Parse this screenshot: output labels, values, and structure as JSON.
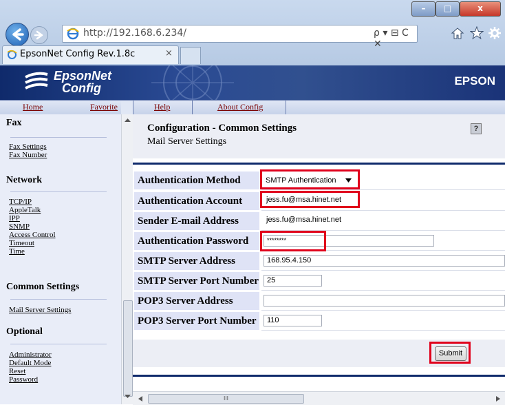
{
  "browser": {
    "url": "http://192.168.6.234/",
    "tab_title": "EpsonNet Config Rev.1.8c",
    "tab_close": "×",
    "search_glyph": "ρ ▾ ⊟ C ✕",
    "minimize": "–",
    "maximize": "□",
    "close": "x"
  },
  "header": {
    "logo_line1": "EpsonNet",
    "logo_line2": "Config",
    "brand": "EPSON"
  },
  "nav": {
    "home": "Home",
    "favorite": "Favorite",
    "help": "Help",
    "about": "About Config"
  },
  "sidebar": {
    "fax": {
      "title": "Fax",
      "links": [
        "Fax Settings",
        "Fax Number"
      ]
    },
    "network": {
      "title": "Network",
      "links": [
        "TCP/IP",
        "AppleTalk",
        "IPP",
        "SNMP",
        "Access Control",
        "Timeout",
        "Time"
      ]
    },
    "common": {
      "title": "Common Settings",
      "links": [
        "Mail Server Settings"
      ]
    },
    "optional": {
      "title": "Optional",
      "links": [
        "Administrator",
        "Default Mode",
        "Reset",
        "Password"
      ]
    }
  },
  "page": {
    "title": "Configuration - Common Settings",
    "subtitle": "Mail Server Settings",
    "help_icon": "?"
  },
  "form": {
    "auth_method": {
      "label": "Authentication Method",
      "value": "SMTP Authentication"
    },
    "auth_account": {
      "label": "Authentication Account",
      "value": "jess.fu@msa.hinet.net"
    },
    "sender_email": {
      "label": "Sender E-mail Address",
      "value": "jess.fu@msa.hinet.net"
    },
    "auth_password": {
      "label": "Authentication Password",
      "value": "********"
    },
    "smtp_address": {
      "label": "SMTP Server Address",
      "value": "168.95.4.150"
    },
    "smtp_port": {
      "label": "SMTP Server Port Number",
      "value": "25"
    },
    "pop3_address": {
      "label": "POP3 Server Address",
      "value": ""
    },
    "pop3_port": {
      "label": "POP3 Server Port Number",
      "value": "110"
    },
    "submit": "Submit"
  },
  "scroll": {
    "h_thumb_glyph": "III"
  },
  "colors": {
    "highlight": "#e0001b",
    "epson_blue": "#0f2a6b",
    "label_bg": "#dfe3f6",
    "link_red": "#7a0000"
  }
}
